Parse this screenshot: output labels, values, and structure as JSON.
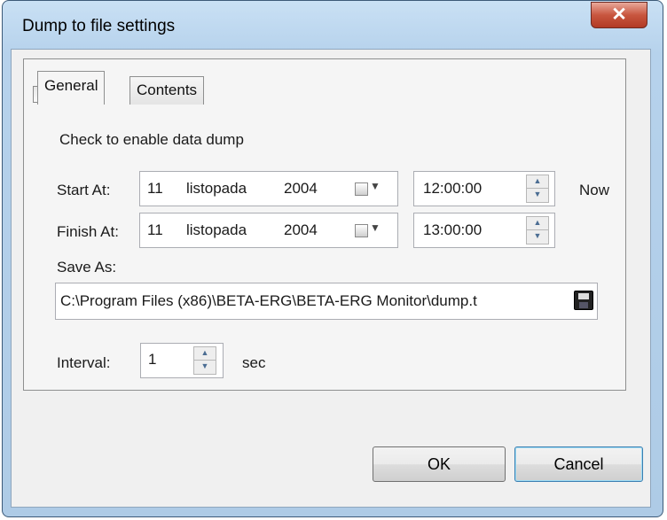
{
  "window": {
    "title": "Dump to file settings",
    "close_glyph": "✕"
  },
  "tabs": [
    {
      "label": "General",
      "active": true
    },
    {
      "label": "Contents",
      "active": false
    }
  ],
  "general": {
    "enable_checkbox": {
      "label": "Check to enable data dump",
      "checked": false
    },
    "start": {
      "label": "Start At:",
      "day": "11",
      "month": "listopada",
      "year": "2004",
      "time": "12:00:00"
    },
    "finish": {
      "label": "Finish At:",
      "day": "11",
      "month": "listopada",
      "year": "2004",
      "time": "13:00:00"
    },
    "now_label": "Now",
    "save_as": {
      "label": "Save As:",
      "path": "C:\\Program Files (x86)\\BETA-ERG\\BETA-ERG Monitor\\dump.t"
    },
    "interval": {
      "label": "Interval:",
      "value": "1",
      "unit": "sec"
    }
  },
  "buttons": {
    "ok": "OK",
    "cancel": "Cancel"
  },
  "icons": {
    "date_picker": "calendar-dropdown-icon",
    "browse": "floppy-disk-icon",
    "spinner": "spin-arrows-icon"
  },
  "colors": {
    "title_bar": "#b6d2ec",
    "close_button": "#c8563f",
    "dialog_bg": "#f0f0f0"
  }
}
